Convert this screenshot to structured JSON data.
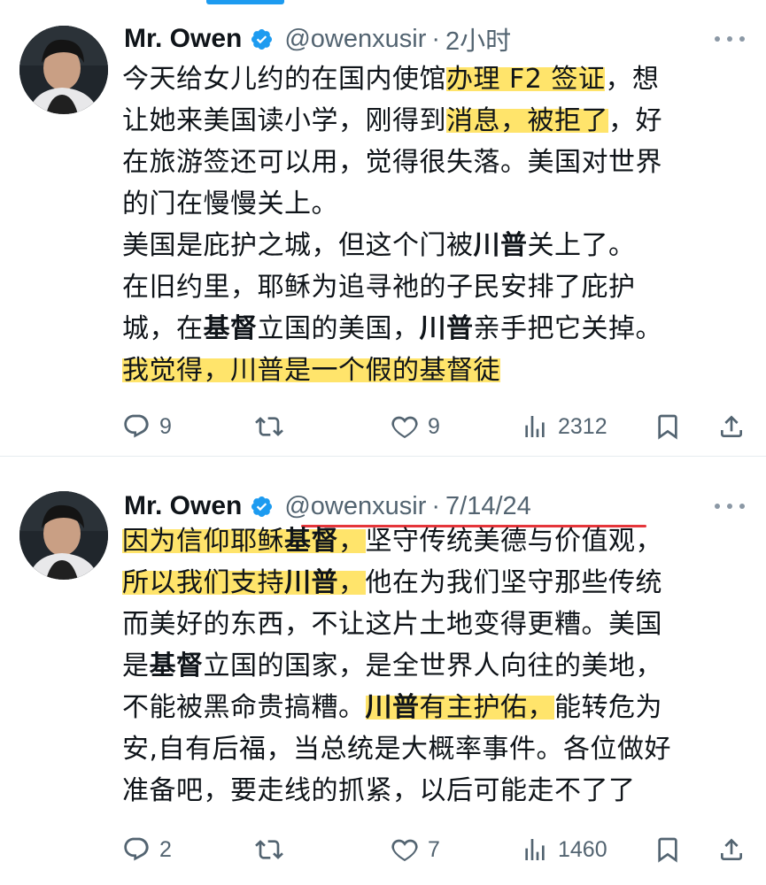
{
  "tweets": [
    {
      "display_name": "Mr. Owen",
      "handle": "@owenxusir",
      "separator": "·",
      "time": "2小时",
      "lines": [
        "今天给女儿约的在国内使馆办理 F2 签证，想",
        "让她来美国读小学，刚得到消息，被拒了，好",
        "在旅游签还可以用，觉得很失落。美国对世界",
        "的门在慢慢关上。",
        "美国是庇护之城，但这个门被川普关上了。",
        "在旧约里，耶稣为追寻祂的子民安排了庇护",
        "城，在基督立国的美国，川普亲手把它关掉。",
        "我觉得，川普是一个假的基督徒"
      ],
      "stats": {
        "replies": "9",
        "retweets": "",
        "likes": "9",
        "views": "2312"
      }
    },
    {
      "display_name": "Mr. Owen",
      "handle": "@owenxusir",
      "separator": "·",
      "time": "7/14/24",
      "lines": [
        "因为信仰耶稣基督，坚守传统美德与价值观，",
        "所以我们支持川普，他在为我们坚守那些传统",
        "而美好的东西，不让这片土地变得更糟。美国",
        "是基督立国的国家，是全世界人向往的美地，",
        "不能被黑命贵搞糟。川普有主护佑，能转危为",
        "安,自有后福，当总统是大概率事件。各位做好",
        "准备吧，要走线的抓紧，以后可能走不了了"
      ],
      "stats": {
        "replies": "2",
        "retweets": "",
        "likes": "7",
        "views": "1460"
      }
    }
  ],
  "icons": {
    "verified": "verified-badge-icon",
    "more": "more-options-icon",
    "reply": "reply-icon",
    "retweet": "retweet-icon",
    "like": "like-icon",
    "views": "views-icon",
    "bookmark": "bookmark-icon",
    "share": "share-icon"
  },
  "colors": {
    "accent": "#1d9bf0",
    "highlight": "#ffe46b",
    "annotation_underline": "#e5353a",
    "secondary_text": "#536471"
  }
}
